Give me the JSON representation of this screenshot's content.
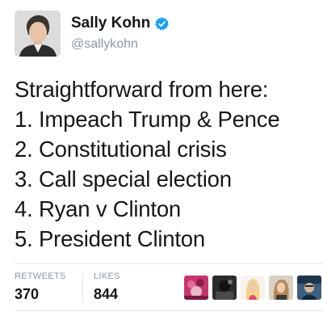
{
  "author": {
    "display_name": "Sally Kohn",
    "handle": "@sallykohn",
    "verified": true,
    "avatar_icon": "profile-photo"
  },
  "tweet": {
    "lines": [
      "Straightforward from here:",
      "1. Impeach Trump & Pence",
      "2. Constitutional crisis",
      "3. Call special election",
      "4. Ryan v Clinton",
      "5. President Clinton"
    ]
  },
  "stats": {
    "retweets_label": "RETWEETS",
    "retweets_value": "370",
    "likes_label": "LIKES",
    "likes_value": "844"
  },
  "likers": [
    {
      "name": "liker-avatar-1",
      "color": "#c8346e"
    },
    {
      "name": "liker-avatar-2",
      "color": "#2b2b2b"
    },
    {
      "name": "liker-avatar-3",
      "color": "#f3d9b8"
    },
    {
      "name": "liker-avatar-4",
      "color": "#b5895a"
    },
    {
      "name": "liker-avatar-5",
      "color": "#3c5f7d"
    }
  ],
  "colors": {
    "verified_blue": "#1da1f2",
    "text": "#14171a",
    "muted": "#8899a6",
    "border": "#e1e8ed"
  }
}
